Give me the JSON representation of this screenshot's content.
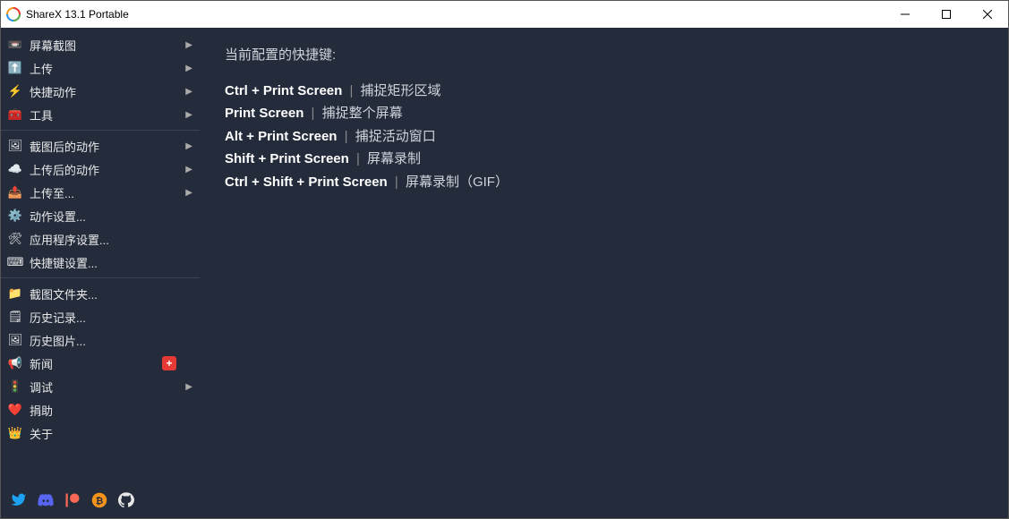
{
  "window": {
    "title": "ShareX 13.1 Portable"
  },
  "sidebar": {
    "groups": [
      [
        {
          "icon": "📼",
          "label": "屏幕截图",
          "arrow": true,
          "name": "menu-capture",
          "iconName": "capture-icon"
        },
        {
          "icon": "⬆️",
          "iconColor": "#2196f3",
          "label": "上传",
          "arrow": true,
          "name": "menu-upload",
          "iconName": "upload-icon"
        },
        {
          "icon": "⚡",
          "iconColor": "#ffb300",
          "label": "快捷动作",
          "arrow": true,
          "name": "menu-workflows",
          "iconName": "workflow-icon"
        },
        {
          "icon": "🧰",
          "iconColor": "#e53935",
          "label": "工具",
          "arrow": true,
          "name": "menu-tools",
          "iconName": "tools-icon"
        }
      ],
      [
        {
          "icon": "🖼",
          "label": "截图后的动作",
          "arrow": true,
          "name": "menu-after-capture",
          "iconName": "after-capture-icon"
        },
        {
          "icon": "☁️",
          "label": "上传后的动作",
          "arrow": true,
          "name": "menu-after-upload",
          "iconName": "after-upload-icon"
        },
        {
          "icon": "📤",
          "label": "上传至...",
          "arrow": true,
          "name": "menu-destinations",
          "iconName": "destinations-icon"
        },
        {
          "icon": "⚙️",
          "label": "动作设置...",
          "arrow": false,
          "name": "menu-task-settings",
          "iconName": "task-settings-icon"
        },
        {
          "icon": "🛠",
          "label": "应用程序设置...",
          "arrow": false,
          "name": "menu-app-settings",
          "iconName": "app-settings-icon"
        },
        {
          "icon": "⌨",
          "label": "快捷键设置...",
          "arrow": false,
          "name": "menu-hotkey-settings",
          "iconName": "hotkey-settings-icon"
        }
      ],
      [
        {
          "icon": "📁",
          "iconColor": "#ffb74d",
          "label": "截图文件夹...",
          "arrow": false,
          "name": "menu-screenshots-folder",
          "iconName": "folder-icon"
        },
        {
          "icon": "🗒",
          "label": "历史记录...",
          "arrow": false,
          "name": "menu-history",
          "iconName": "history-icon"
        },
        {
          "icon": "🖼",
          "label": "历史图片...",
          "arrow": false,
          "name": "menu-image-history",
          "iconName": "image-history-icon"
        },
        {
          "icon": "📢",
          "iconColor": "#ef5350",
          "label": "新闻",
          "arrow": false,
          "badge": "+",
          "name": "menu-news",
          "iconName": "news-icon"
        },
        {
          "icon": "🚦",
          "label": "调试",
          "arrow": true,
          "name": "menu-debug",
          "iconName": "debug-icon"
        },
        {
          "icon": "❤️",
          "label": "捐助",
          "arrow": false,
          "name": "menu-donate",
          "iconName": "donate-icon"
        },
        {
          "icon": "👑",
          "iconColor": "#ffd54f",
          "label": "关于",
          "arrow": false,
          "name": "menu-about",
          "iconName": "about-icon"
        }
      ]
    ]
  },
  "social": [
    {
      "name": "twitter-icon",
      "color": "#1da1f2",
      "svg": "twitter"
    },
    {
      "name": "discord-icon",
      "color": "#5865f2",
      "svg": "discord"
    },
    {
      "name": "patreon-icon",
      "color": "#f96854",
      "svg": "patreon"
    },
    {
      "name": "bitcoin-icon",
      "color": "#f7931a",
      "svg": "bitcoin"
    },
    {
      "name": "github-icon",
      "color": "#e8e8e8",
      "svg": "github"
    }
  ],
  "content": {
    "heading": "当前配置的快捷键:",
    "hotkeys": [
      {
        "keys": "Ctrl + Print Screen",
        "action": "捕捉矩形区域"
      },
      {
        "keys": "Print Screen",
        "action": "捕捉整个屏幕"
      },
      {
        "keys": "Alt + Print Screen",
        "action": "捕捉活动窗口"
      },
      {
        "keys": "Shift + Print Screen",
        "action": "屏幕录制"
      },
      {
        "keys": "Ctrl + Shift + Print Screen",
        "action": "屏幕录制（GIF）"
      }
    ]
  }
}
